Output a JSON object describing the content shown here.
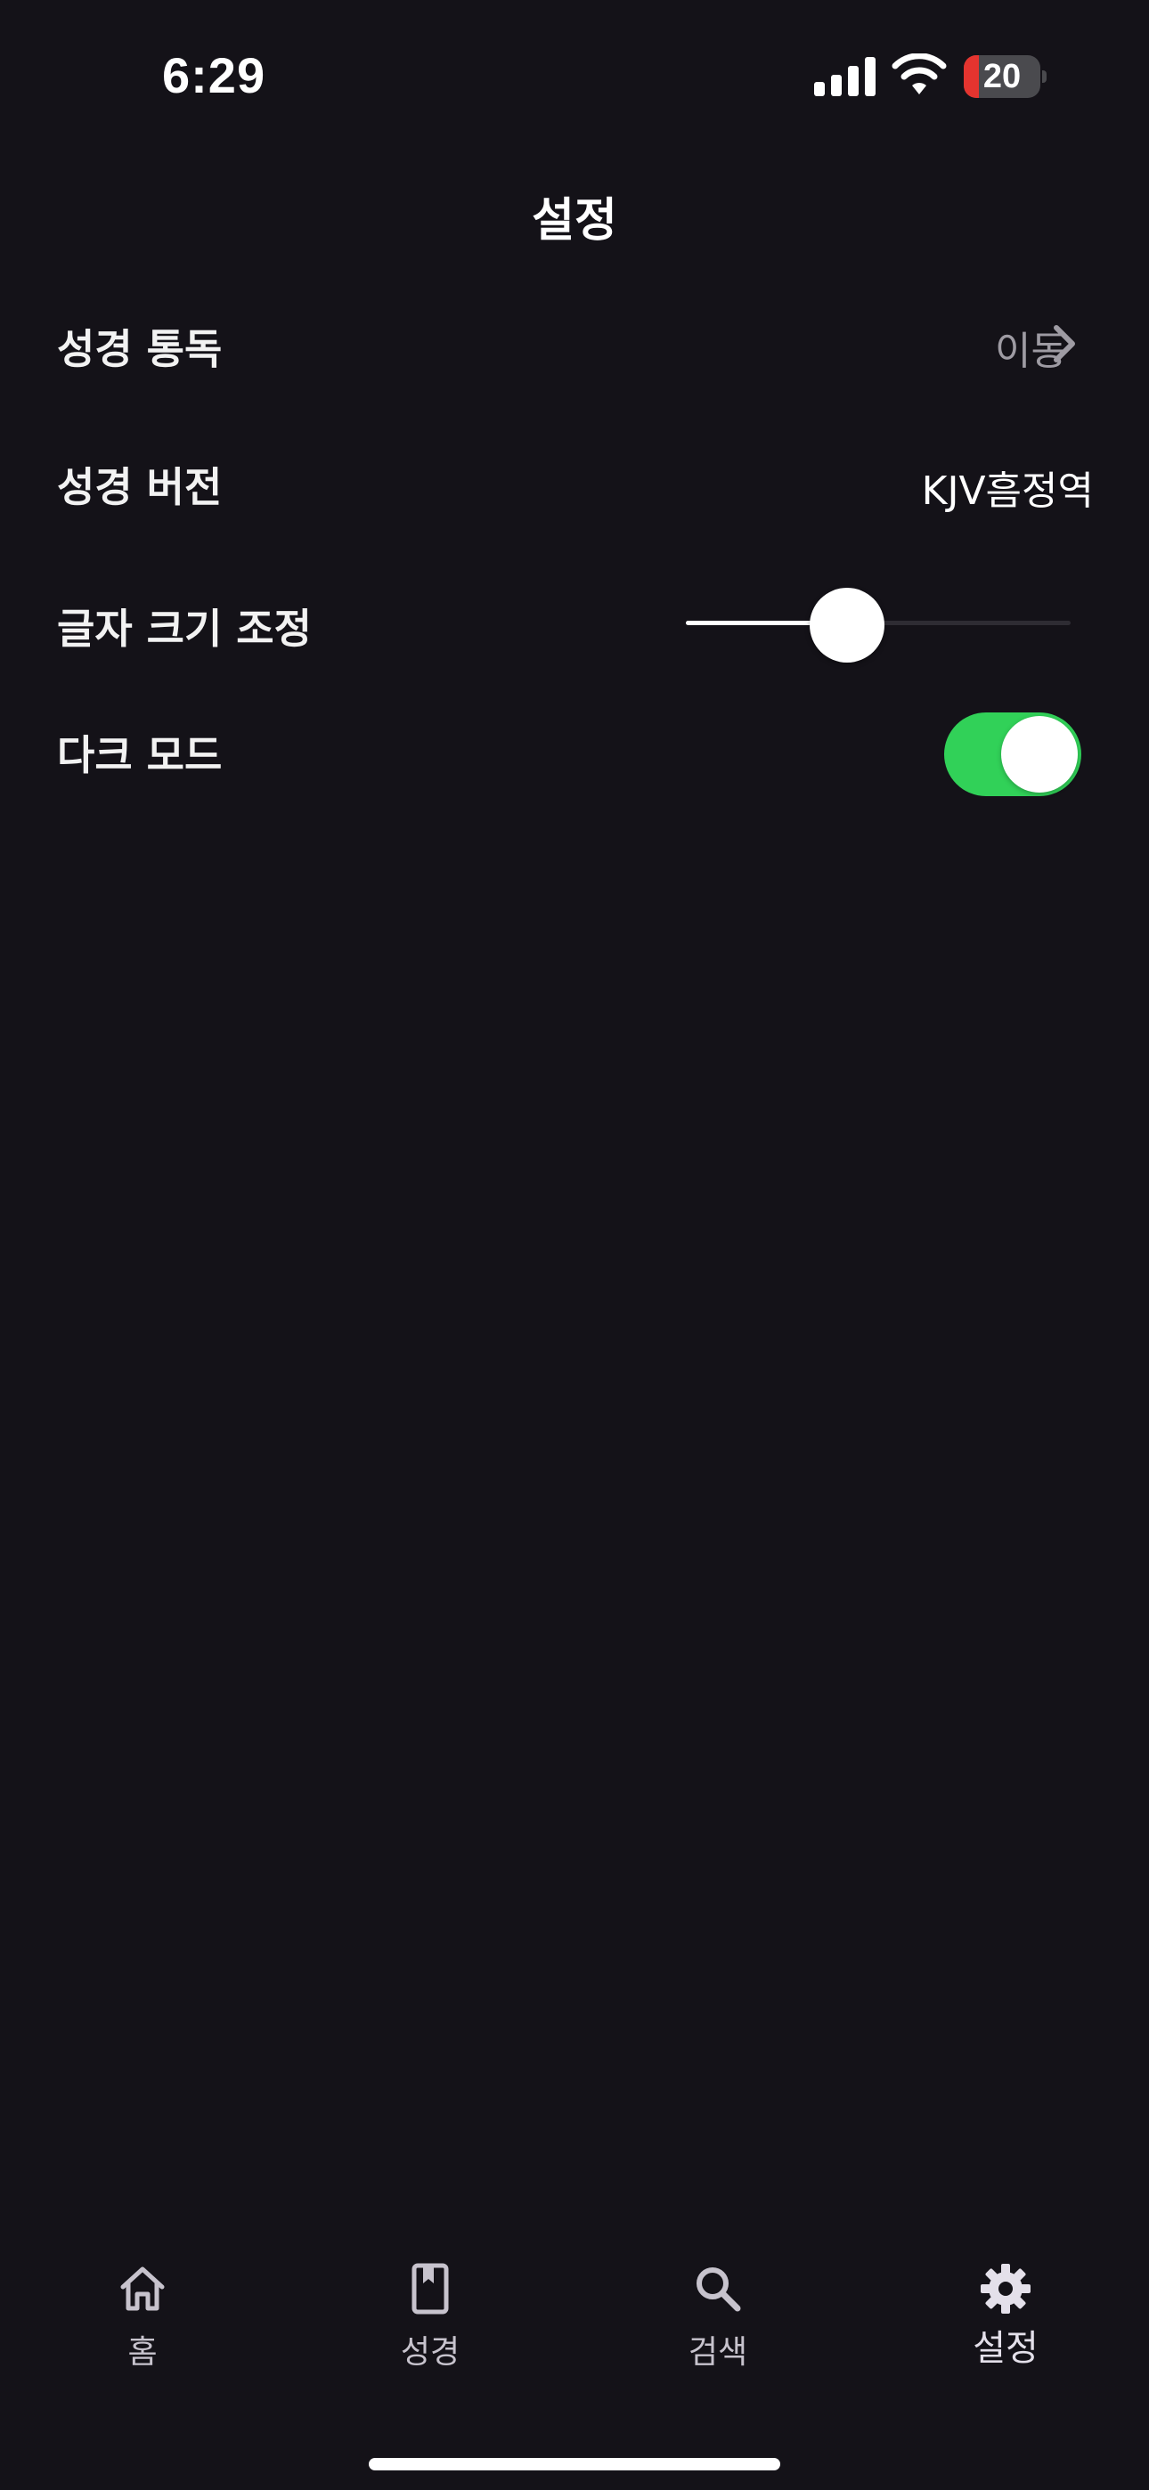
{
  "status_bar": {
    "time": "6:29",
    "battery_level": "20",
    "battery_color": "#e5342f"
  },
  "header": {
    "title": "설정"
  },
  "settings": {
    "reading_plan": {
      "label": "성경 통독",
      "value": "이동",
      "icon": "chevron-right-icon"
    },
    "bible_version": {
      "label": "성경 버전",
      "value": "KJV흠정역"
    },
    "font_size": {
      "label": "글자 크기 조정",
      "slider_value": 0.42
    },
    "dark_mode": {
      "label": "다크 모드",
      "enabled": true,
      "accent_color": "#31d158"
    }
  },
  "tab_bar": {
    "tabs": [
      {
        "label": "홈",
        "icon": "home-icon"
      },
      {
        "label": "성경",
        "icon": "book-icon"
      },
      {
        "label": "검색",
        "icon": "search-icon"
      },
      {
        "label": "설정",
        "icon": "gear-icon",
        "active": true
      }
    ]
  }
}
